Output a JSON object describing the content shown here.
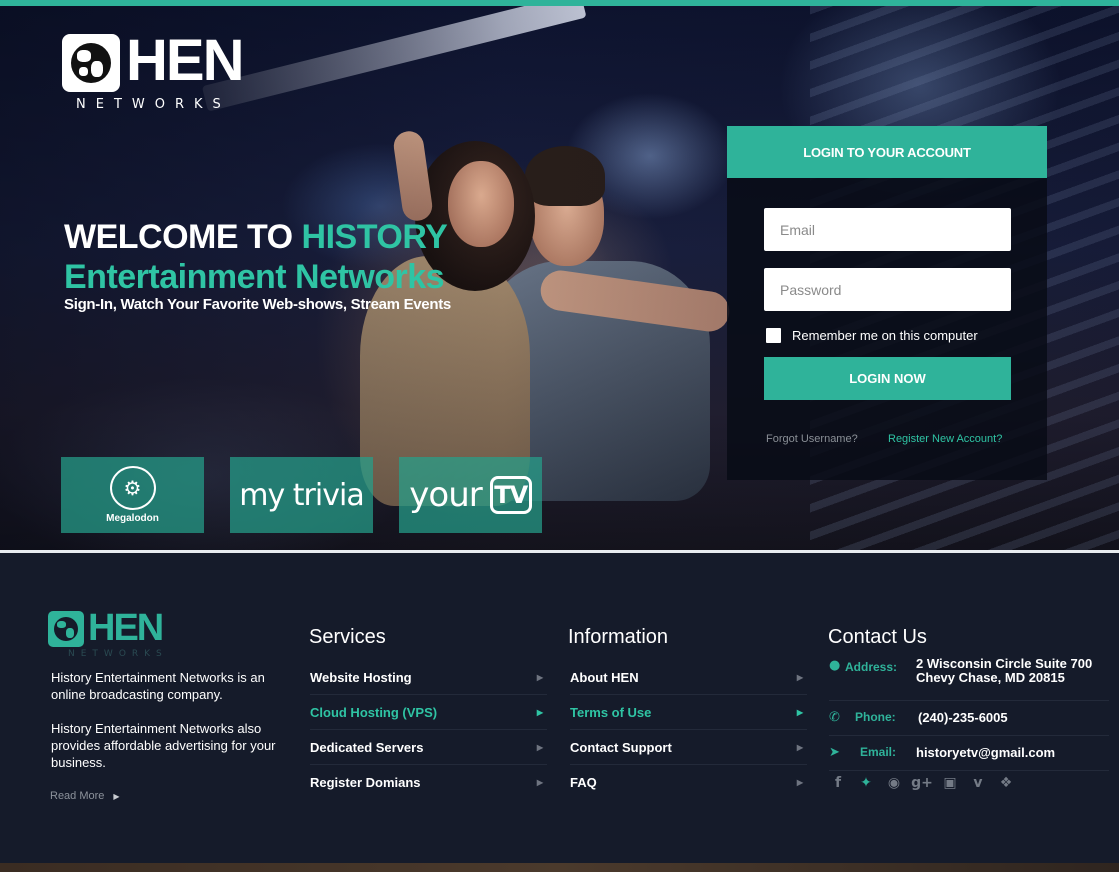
{
  "header": {
    "logo_text": "HEN",
    "logo_subtext": "NETWORKS"
  },
  "hero": {
    "welcome_prefix": "WELCOME TO",
    "welcome_accent": "HISTORY",
    "welcome_line2": "Entertainment Networks",
    "tagline": "Sign-In, Watch Your Favorite Web-shows, Stream Events",
    "brands": [
      {
        "name": "Megalodon",
        "icon": "megalodon-logo"
      },
      {
        "name": "my trivia"
      },
      {
        "name": "your",
        "tv": "TV"
      }
    ]
  },
  "login": {
    "title": "LOGIN TO YOUR ACCOUNT",
    "email_placeholder": "Email",
    "password_placeholder": "Password",
    "remember_label": "Remember me on this computer",
    "submit_label": "LOGIN NOW",
    "forgot_label": "Forgot Username?",
    "register_label": "Register New Account?"
  },
  "footer": {
    "logo_text": "HEN",
    "logo_subtext": "NETWORKS",
    "about": [
      "History Entertainment Networks is an online broadcasting company.",
      "History Entertainment Networks also provides affordable advertising for your business."
    ],
    "read_more": "Read More",
    "services": {
      "title": "Services",
      "items": [
        "Website Hosting",
        "Cloud Hosting (VPS)",
        "Dedicated Servers",
        "Register Domians"
      ]
    },
    "information": {
      "title": "Information",
      "items": [
        "About HEN",
        "Terms of Use",
        "Contact Support",
        "FAQ"
      ]
    },
    "contact": {
      "title": "Contact Us",
      "address_label": "Address:",
      "address_line1": "2 Wisconsin Circle Suite 700",
      "address_line2": "Chevy Chase, MD 20815",
      "phone_label": "Phone:",
      "phone": "(240)-235-6005",
      "email_label": "Email:",
      "email": "historyetv@gmail.com"
    },
    "social_icons": [
      "facebook-icon",
      "twitter-icon",
      "dribbble-icon",
      "google-plus-icon",
      "instagram-icon",
      "vimeo-icon",
      "dropbox-icon"
    ]
  },
  "colors": {
    "accent": "#2fb39a",
    "footer_bg": "#151b2a"
  }
}
